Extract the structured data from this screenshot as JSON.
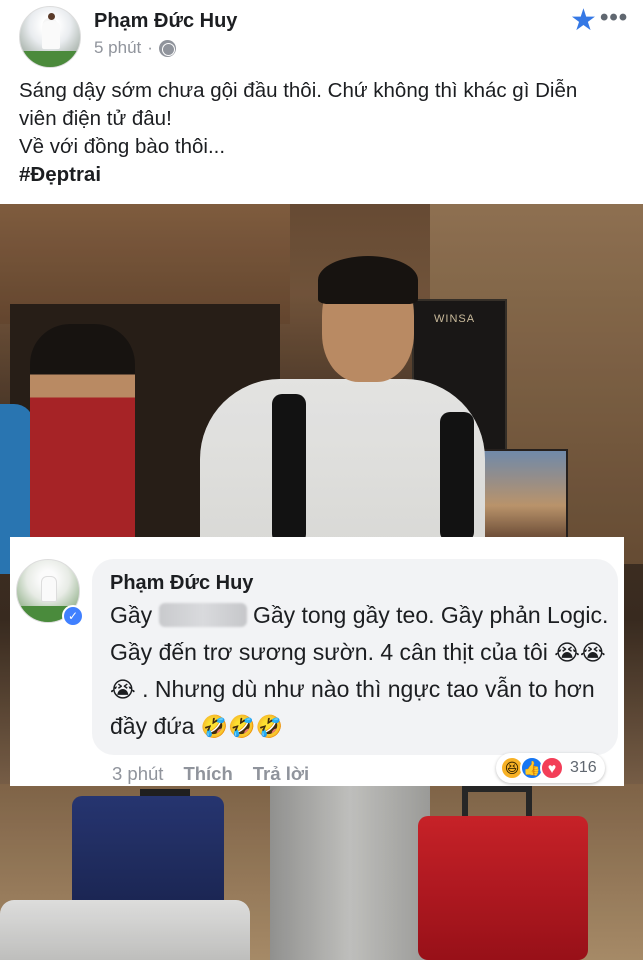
{
  "post": {
    "author": "Phạm Đức Huy",
    "time": "5 phút",
    "separator": "·",
    "text_lines": [
      "Sáng dậy sớm chưa gội đầu thôi. Chứ không thì khác gì Diễn",
      "viên điện tử đâu!",
      "Về với đồng bào thôi..."
    ],
    "hashtag": "#Đẹptrai",
    "icons": {
      "privacy": "globe-icon",
      "favorite": "star-icon",
      "more": "more-icon"
    },
    "photo": {
      "sign_text": "WINSA"
    }
  },
  "comment": {
    "author": "Phạm Đức Huy",
    "text_part1": "Gầy",
    "text_part2": "Gầy tong gầy teo. Gầy phản Logic. Gầy đến trơ sương sườn. 4 cân thịt của tôi",
    "cry_emojis": "😭😭😭",
    "text_part3": ". Nhưng dù như nào thì ngực tao vẫn to hơn đầy đứa",
    "laugh_emojis": "🤣🤣🤣",
    "time": "3 phút",
    "like_label": "Thích",
    "reply_label": "Trả lời",
    "reactions": {
      "types": [
        "haha",
        "like",
        "love"
      ],
      "count": "316"
    }
  },
  "colors": {
    "accent": "#3578e5",
    "meta_text": "#90949c",
    "bubble_bg": "#f2f3f5"
  }
}
